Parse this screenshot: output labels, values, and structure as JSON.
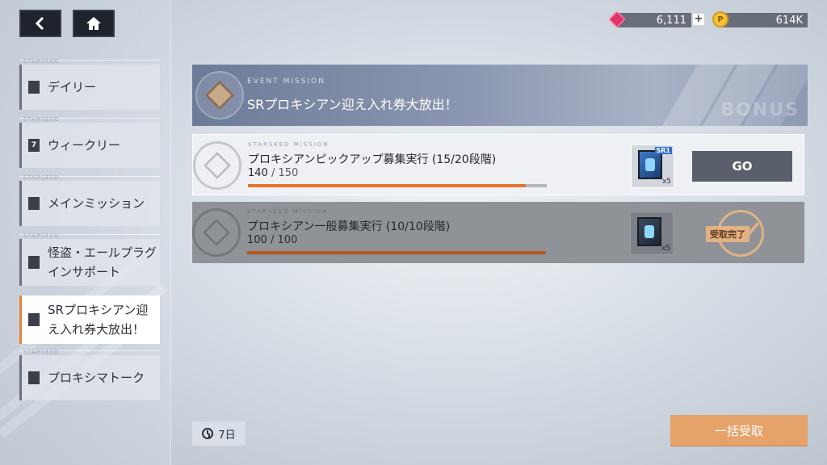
{
  "nav": {
    "back_icon": "back-arrow-icon",
    "home_icon": "home-icon",
    "items": [
      {
        "tag": "STARSEED",
        "label": "デイリー",
        "icon": "document-icon"
      },
      {
        "tag": "STARSEED",
        "label": "ウィークリー",
        "icon": "calendar-7-icon",
        "icon_text": "7"
      },
      {
        "tag": "STARSEED",
        "label": "メインミッション",
        "icon": "list-icon"
      },
      {
        "tag": "STARSEED",
        "label": "怪盗・エールプラグインサポート",
        "icon": "chart-icon"
      },
      {
        "tag": "",
        "label": "SRプロキシアン迎え入れ券大放出！",
        "icon": "document-icon",
        "active": true
      },
      {
        "tag": "STARSEED",
        "label": "プロキシマトーク",
        "icon": "document-icon"
      }
    ]
  },
  "currency": {
    "gem_value": "6,111",
    "plus_label": "+",
    "coin_value": "614K",
    "coin_symbol": "P"
  },
  "banner": {
    "tag": "EVENT MISSION",
    "title": "SRプロキシアン迎え入れ券大放出！",
    "deco_text": "BONUS"
  },
  "missions": [
    {
      "tag": "STARSEED MISSION",
      "title": "プロキシアンピックアップ募集実行 (15/20段階)",
      "current": "140",
      "total": "150",
      "progress": 0.93,
      "reward_rarity": "SR1",
      "reward_qty": "x5",
      "action": "GO",
      "completed": false
    },
    {
      "tag": "STARSEED MISSION",
      "title": "プロキシアン一般募集実行 (10/10段階)",
      "current": "100",
      "total": "100",
      "progress": 1.0,
      "reward_qty": "x5",
      "action": "受取完了",
      "completed": true
    }
  ],
  "timer": {
    "label": "7日"
  },
  "claim_all": {
    "label": "一括受取"
  },
  "colors": {
    "accent": "#e8742c",
    "claim_button": "#e5a36a",
    "go_button": "#5a606b",
    "completed_stamp": "#e2b184"
  }
}
